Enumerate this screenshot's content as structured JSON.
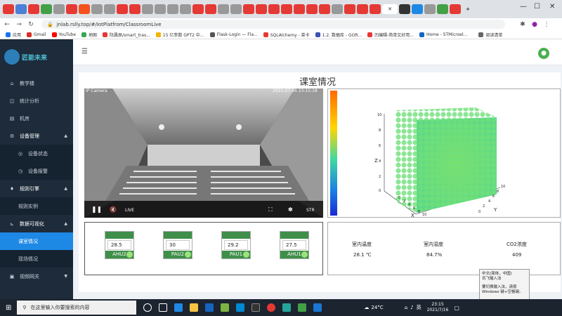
{
  "browser": {
    "url": "jnlab.rslly.top/#/IotPlatfrom/ClassroomLive",
    "bookmarks": [
      "应用",
      "Gmail",
      "YouTube",
      "地图",
      "阮晨辰/smart_tras...",
      "15 亿参数 GPT2 中...",
      "Flask-Login — Fla...",
      "SQLAlchemy - 菜卡",
      "1.2. 数据库 - GOR...",
      "凹编辑-简单又好用...",
      "Home - STMicroel..."
    ],
    "reading_list": "阅读清单"
  },
  "sidebar": {
    "logo_text": "匠能未来",
    "items": [
      {
        "label": "教学楼",
        "icon": "home-icon"
      },
      {
        "label": "统计分析",
        "icon": "chart-icon"
      },
      {
        "label": "机房",
        "icon": "server-icon"
      },
      {
        "label": "设备管理",
        "icon": "gear-icon"
      },
      {
        "label": "设备状态",
        "icon": "status-icon"
      },
      {
        "label": "设备报警",
        "icon": "alarm-icon"
      },
      {
        "label": "规则引擎",
        "icon": "rule-icon"
      },
      {
        "label": "规则实例",
        "icon": ""
      },
      {
        "label": "数据可视化",
        "icon": "chart-icon"
      },
      {
        "label": "课室情况",
        "icon": ""
      },
      {
        "label": "现场情况",
        "icon": ""
      },
      {
        "label": "视频网关",
        "icon": "video-icon"
      }
    ]
  },
  "page": {
    "title": "课室情况"
  },
  "camera": {
    "label": "IP Camera",
    "timestamp": "2021-07-16 23:15:18",
    "live_label": "LIVE",
    "str_label": "STR"
  },
  "heatmap3d": {
    "axis_z": "Z",
    "axis_x": "X",
    "axis_y": "Y",
    "ticks_z": [
      "10",
      "8",
      "6",
      "4",
      "2",
      "0"
    ],
    "ticks_x": [
      "0",
      "2",
      "4",
      "6",
      "8",
      "10"
    ],
    "ticks_y": [
      "0",
      "2",
      "4",
      "6",
      "8",
      "10"
    ]
  },
  "ahu": [
    {
      "name": "AHU2",
      "value": "28.5"
    },
    {
      "name": "PAU2",
      "value": "30"
    },
    {
      "name": "PAU1",
      "value": "29.2"
    },
    {
      "name": "AHU1",
      "value": "27.5"
    }
  ],
  "env": {
    "temp_label": "室内温度",
    "temp_value": "28.1 ℃",
    "hum_label": "室内湿度",
    "hum_value": "84.7%",
    "co2_label": "CO2浓度",
    "co2_value": "409"
  },
  "taskbar": {
    "search_placeholder": "在这里输入你要搜索的内容",
    "weather": "24°C",
    "time": "23:15",
    "date": "2021/7/16",
    "lang": "英"
  },
  "ime_popup": {
    "line1": "中文(简体，中国)",
    "line2": "讯飞输入法",
    "line3": "要切换输入法，请按",
    "line4": "Windows 键+空格键。"
  }
}
